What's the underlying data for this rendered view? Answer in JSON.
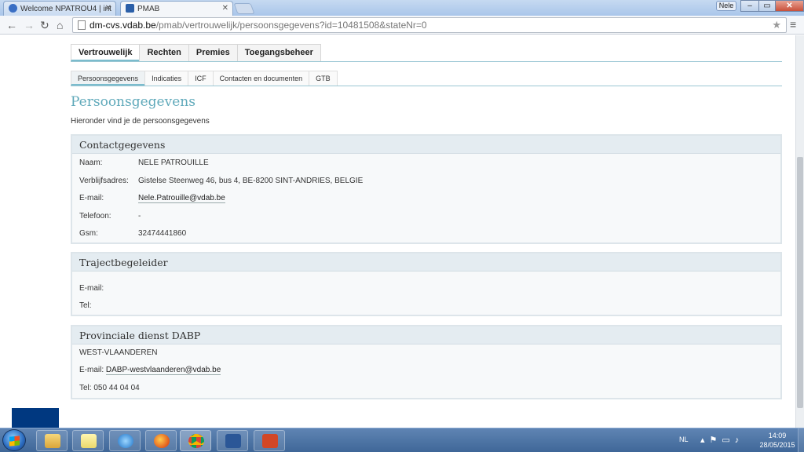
{
  "browser": {
    "tabs": [
      {
        "title": "Welcome NPATROU4 | int",
        "active": false
      },
      {
        "title": "PMAB",
        "active": true
      }
    ],
    "user_badge": "Nele",
    "address": {
      "host": "dm-cvs.vdab.be",
      "path": "/pmab/vertrouwelijk/persoonsgegevens?id=10481508&stateNr=0"
    }
  },
  "main_tabs": [
    {
      "label": "Vertrouwelijk",
      "selected": true
    },
    {
      "label": "Rechten",
      "selected": false
    },
    {
      "label": "Premies",
      "selected": false
    },
    {
      "label": "Toegangsbeheer",
      "selected": false
    }
  ],
  "sub_tabs": [
    {
      "label": "Persoonsgegevens",
      "selected": true
    },
    {
      "label": "Indicaties",
      "selected": false
    },
    {
      "label": "ICF",
      "selected": false
    },
    {
      "label": "Contacten en documenten",
      "selected": false
    },
    {
      "label": "GTB",
      "selected": false
    }
  ],
  "page": {
    "title": "Persoonsgegevens",
    "intro": "Hieronder vind je de persoonsgegevens"
  },
  "contact": {
    "heading": "Contactgegevens",
    "naam_label": "Naam:",
    "naam_value": "NELE PATROUILLE",
    "adres_label": "Verblijfsadres:",
    "adres_value": "Gistelse Steenweg 46, bus 4, BE-8200 SINT-ANDRIES, BELGIE",
    "email_label": "E-mail:",
    "email_value": "Nele.Patrouille@vdab.be",
    "telefoon_label": "Telefoon:",
    "telefoon_value": "-",
    "gsm_label": "Gsm:",
    "gsm_value": "32474441860"
  },
  "trajectbegeleider": {
    "heading": "Trajectbegeleider",
    "email_label": "E-mail:",
    "tel_label": "Tel:"
  },
  "provinciale_dienst": {
    "heading": "Provinciale dienst DABP",
    "region": "WEST-VLAANDEREN",
    "email_label": "E-mail:",
    "email_value": "DABP-westvlaanderen@vdab.be",
    "tel_text": "Tel: 050 44 04 04"
  },
  "taskbar": {
    "apps": [
      "explorer",
      "notes",
      "internet-explorer",
      "firefox",
      "chrome",
      "word",
      "powerpoint"
    ],
    "language": "NL",
    "time": "14:09",
    "date": "28/05/2015"
  },
  "colors": {
    "accent": "#5fa9ba",
    "tab_underline": "#7bbccd",
    "panel_header": "#e4ecf1",
    "brand_blue": "#003880"
  }
}
